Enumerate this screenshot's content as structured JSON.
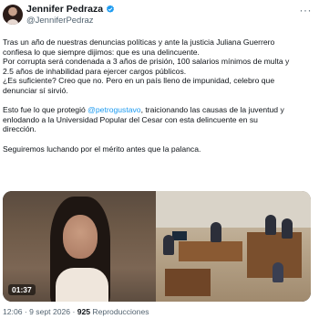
{
  "author": {
    "name": "Jennifer Pedraza",
    "handle": "@JenniferPedraz",
    "verified_color": "#1d9bf0"
  },
  "menu": {
    "label": "···"
  },
  "tweet": {
    "paragraph1_line1": "Tras un año de nuestras denuncias políticas y ante la justicia Juliana Guerrero",
    "paragraph1_line2": "confiesa lo que siempre dijimos: que es una delincuente.",
    "paragraph1_line3": "Por corrupta será condenada a 3 años de prisión, 100 salarios mínimos de multa y",
    "paragraph1_line4": "2.5 años de inhabilidad para ejercer cargos públicos.",
    "paragraph1_line5": "¿Es suficiente? Creo que no. Pero en un país lleno de impunidad, celebro que",
    "paragraph1_line6": "denunciar sí sirvió.",
    "paragraph2_prefix": "Esto fue lo que protegió ",
    "paragraph2_mention": "@petrogustavo",
    "paragraph2_suffix": ", traicionando las causas de la juventud y",
    "paragraph2_line2": "enlodando a la Universidad Popular del Cesar con esta delincuente en su",
    "paragraph2_line3": "dirección.",
    "paragraph3": "Seguiremos luchando por el mérito antes que la palanca."
  },
  "video": {
    "duration": "01:37"
  },
  "meta": {
    "time": "12:06 · 9 sept 2026 · ",
    "views_count": "925",
    "views_label": " Reproducciones"
  }
}
